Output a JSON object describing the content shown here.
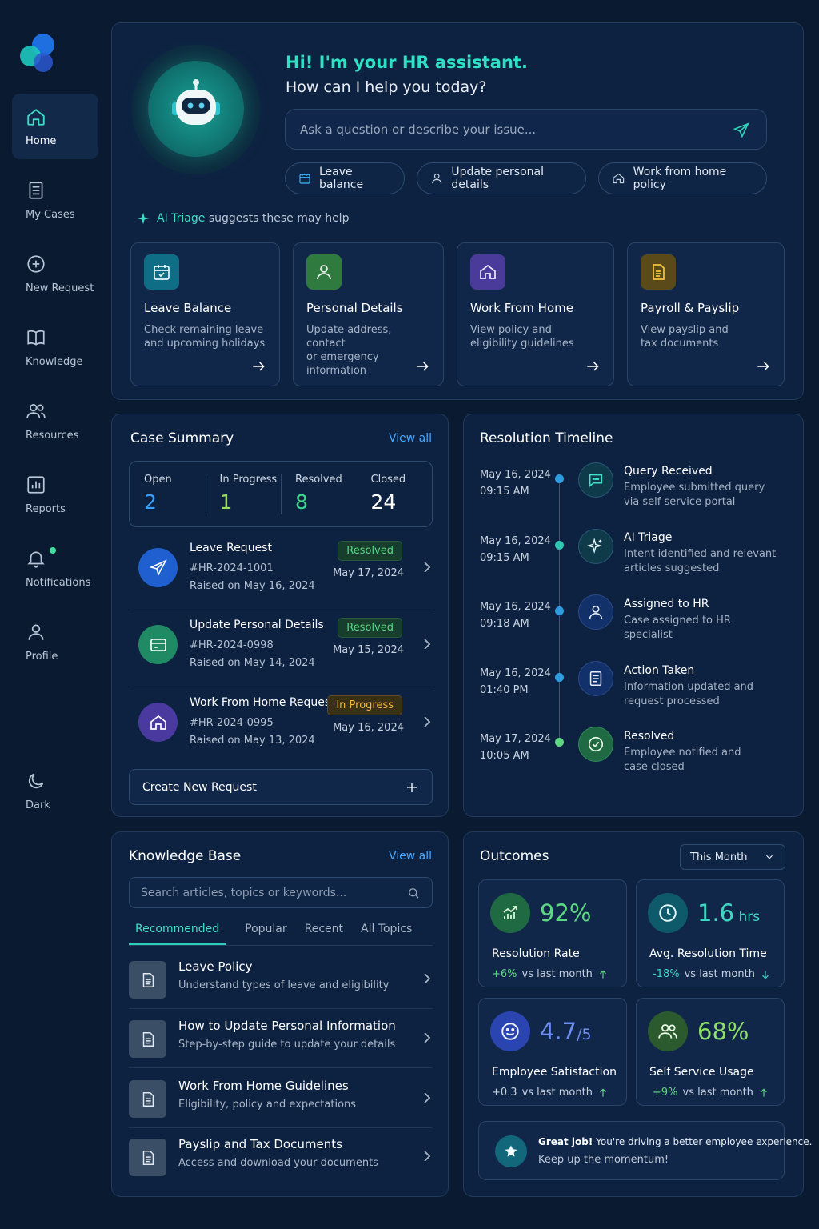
{
  "sidebar": {
    "items": [
      {
        "label": "Home",
        "icon": "home-icon"
      },
      {
        "label": "My Cases",
        "icon": "document-list-icon"
      },
      {
        "label": "New Request",
        "icon": "plus-circle-icon"
      },
      {
        "label": "Knowledge",
        "icon": "book-icon"
      },
      {
        "label": "Resources",
        "icon": "users-icon"
      },
      {
        "label": "Reports",
        "icon": "bar-chart-icon"
      },
      {
        "label": "Notifications",
        "icon": "bell-icon"
      },
      {
        "label": "Profile",
        "icon": "user-icon"
      }
    ],
    "dark_label": "Dark"
  },
  "hero": {
    "greeting": "Hi! I'm your HR assistant.",
    "subtitle": "How can I help you today?",
    "ask_placeholder": "Ask a question or describe your issue...",
    "chips": [
      "Leave balance",
      "Update personal details",
      "Work from home policy"
    ],
    "triage_brand": "AI Triage",
    "triage_text": "suggests these may help",
    "cards": [
      {
        "title": "Leave Balance",
        "desc1": "Check remaining leave",
        "desc2": "and upcoming holidays",
        "color": "#0f6d86"
      },
      {
        "title": "Personal Details",
        "desc1": "Update address, contact",
        "desc2": "or emergency information",
        "color": "#2f7a3e"
      },
      {
        "title": "Work From Home",
        "desc1": "View policy and",
        "desc2": "eligibility guidelines",
        "color": "#4a3a9a"
      },
      {
        "title": "Payroll & Payslip",
        "desc1": "View payslip and",
        "desc2": "tax documents",
        "color": "#5a4a1a"
      }
    ]
  },
  "case_summary": {
    "title": "Case Summary",
    "view_all": "View all",
    "stats": [
      {
        "label": "Open",
        "value": "2",
        "color": "#3aa0ff"
      },
      {
        "label": "In Progress",
        "value": "1",
        "color": "#9be05a"
      },
      {
        "label": "Resolved",
        "value": "8",
        "color": "#3dd68c"
      },
      {
        "label": "Closed",
        "value": "24",
        "color": "#ffffff"
      }
    ],
    "cases": [
      {
        "title": "Leave Request",
        "id": "#HR-2024-1001",
        "raised": "Raised on May 16, 2024",
        "status": "Resolved",
        "date": "May 17, 2024"
      },
      {
        "title": "Update Personal Details",
        "id": "#HR-2024-0998",
        "raised": "Raised on May 14, 2024",
        "status": "Resolved",
        "date": "May 15, 2024"
      },
      {
        "title": "Work From Home Request",
        "id": "#HR-2024-0995",
        "raised": "Raised on May 13, 2024",
        "status": "In Progress",
        "date": "May 16, 2024"
      }
    ],
    "create_label": "Create New Request"
  },
  "timeline": {
    "title": "Resolution Timeline",
    "events": [
      {
        "date": "May 16, 2024",
        "time": "09:15 AM",
        "title": "Query Received",
        "d1": "Employee submitted query",
        "d2": "via self service portal"
      },
      {
        "date": "May 16, 2024",
        "time": "09:15 AM",
        "title": "AI Triage",
        "d1": "Intent identified and relevant",
        "d2": "articles suggested"
      },
      {
        "date": "May 16, 2024",
        "time": "09:18 AM",
        "title": "Assigned to HR",
        "d1": "Case assigned to HR",
        "d2": "specialist"
      },
      {
        "date": "May 16, 2024",
        "time": "01:40 PM",
        "title": "Action Taken",
        "d1": "Information updated and",
        "d2": "request processed"
      },
      {
        "date": "May 17, 2024",
        "time": "10:05 AM",
        "title": "Resolved",
        "d1": "Employee notified and",
        "d2": "case closed"
      }
    ]
  },
  "knowledge": {
    "title": "Knowledge Base",
    "view_all": "View all",
    "search_placeholder": "Search articles, topics or keywords...",
    "tabs": [
      "Recommended",
      "Popular",
      "Recent",
      "All Topics"
    ],
    "articles": [
      {
        "title": "Leave Policy",
        "sub": "Understand types of leave and eligibility"
      },
      {
        "title": "How to Update Personal Information",
        "sub": "Step-by-step guide to update your details"
      },
      {
        "title": "Work From Home Guidelines",
        "sub": "Eligibility, policy and expectations"
      },
      {
        "title": "Payslip and Tax Documents",
        "sub": "Access and download your documents"
      }
    ]
  },
  "outcomes": {
    "title": "Outcomes",
    "period": "This Month",
    "cards": [
      {
        "value": "92%",
        "unit": "",
        "label": "Resolution Rate",
        "delta": "+6%",
        "vs": "vs last month",
        "color": "#5fd883"
      },
      {
        "value": "1.6",
        "unit": " hrs",
        "label": "Avg. Resolution Time",
        "delta": "-18%",
        "vs": "vs last month",
        "color": "#3fd6c2"
      },
      {
        "value": "4.7",
        "unit": "/5",
        "label": "Employee Satisfaction",
        "delta": "+0.3",
        "vs": "vs last month",
        "color": "#6e8ef0"
      },
      {
        "value": "68%",
        "unit": "",
        "label": "Self Service Usage",
        "delta": "+9%",
        "vs": "vs last month",
        "color": "#8ee06a"
      }
    ],
    "great_bold": "Great job!",
    "great_text": "You're driving a better employee experience.",
    "great_sub": "Keep up the momentum!"
  }
}
